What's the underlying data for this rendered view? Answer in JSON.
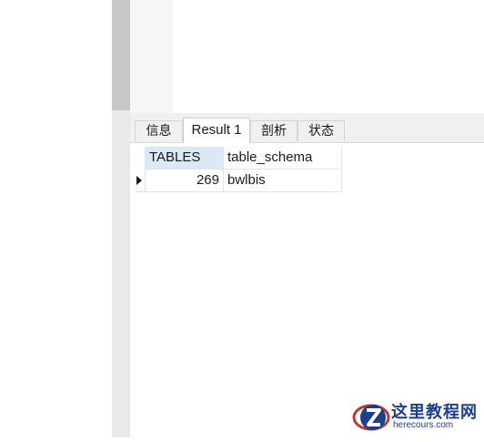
{
  "result_tabs": [
    {
      "label": "信息",
      "active": false
    },
    {
      "label": "Result 1",
      "active": true
    },
    {
      "label": "剖析",
      "active": false
    },
    {
      "label": "状态",
      "active": false
    }
  ],
  "grid": {
    "columns": [
      "TABLES",
      "table_schema"
    ],
    "rows": [
      {
        "TABLES": "269",
        "table_schema": "bwlbis"
      }
    ]
  },
  "watermark": {
    "brand": "这里教程网",
    "url": "herecours.com"
  },
  "colors": {
    "header_selected": "#dbe8f6",
    "scrollbar_thumb": "#c7c7c7",
    "watermark": "#1b3f8f",
    "watermark_accent": "#c0392b"
  }
}
